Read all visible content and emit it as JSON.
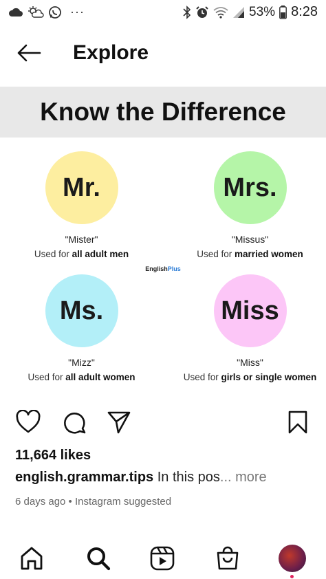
{
  "status_bar": {
    "battery_percent": "53%",
    "time": "8:28",
    "overflow": "···"
  },
  "header": {
    "title": "Explore"
  },
  "post_image": {
    "title": "Know the Difference",
    "brand": "English",
    "brand_suffix": "Plus",
    "items": [
      {
        "label": "Mr.",
        "color": "#fdeea0",
        "pronunciation": "\"Mister\"",
        "used_prefix": "Used for ",
        "used_bold": "all adult men"
      },
      {
        "label": "Mrs.",
        "color": "#b5f5a8",
        "pronunciation": "\"Missus\"",
        "used_prefix": "Used for ",
        "used_bold": "married women"
      },
      {
        "label": "Ms.",
        "color": "#b3eff8",
        "pronunciation": "\"Mizz\"",
        "used_prefix": "Used for ",
        "used_bold": "all adult women"
      },
      {
        "label": "Miss",
        "color": "#fcc6f7",
        "pronunciation": "\"Miss\"",
        "used_prefix": "Used for ",
        "used_bold": "girls or single women"
      }
    ]
  },
  "post": {
    "likes": "11,664 likes",
    "username": "english.grammar.tips",
    "caption": " In this pos",
    "more": "... more",
    "meta": "6 days ago • Instagram suggested"
  }
}
